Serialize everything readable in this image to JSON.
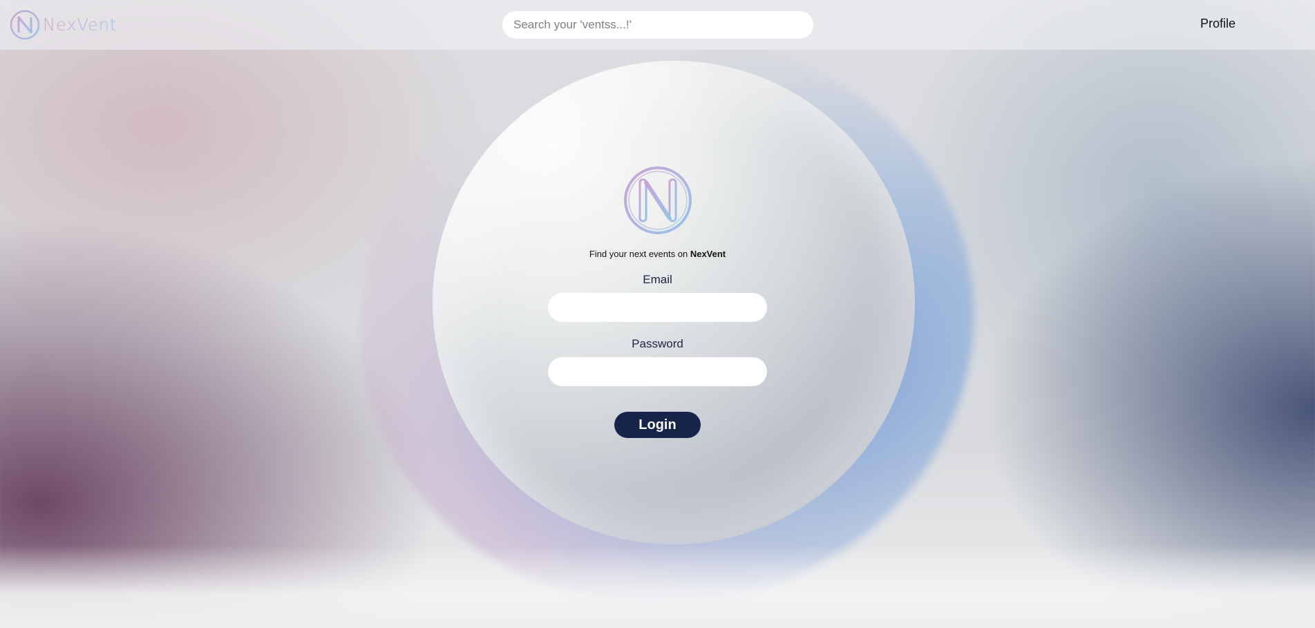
{
  "header": {
    "brand_name": "NexVent",
    "search": {
      "placeholder": "Search your 'ventss...!'",
      "value": ""
    },
    "profile_label": "Profile"
  },
  "login": {
    "tagline_prefix": "Find your next events on ",
    "tagline_brand": "NexVent",
    "email_label": "Email",
    "email_value": "",
    "password_label": "Password",
    "password_value": "",
    "login_label": "Login"
  },
  "colors": {
    "accent": "#162449",
    "logo_gradient_start": "#c6a6d0",
    "logo_gradient_end": "#9fc0e6"
  },
  "icons": {
    "brand_logo": "nexvent-logo-icon",
    "login_logo": "nexvent-logo-icon"
  }
}
